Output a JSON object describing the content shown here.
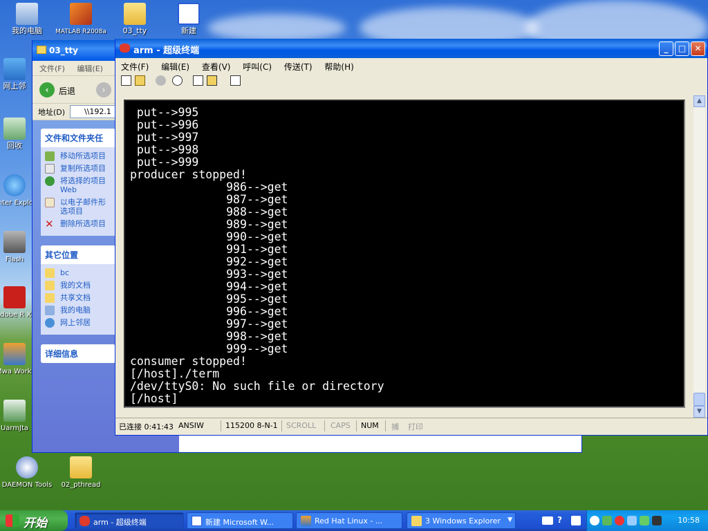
{
  "desktop": {
    "icons": [
      {
        "label": "我的电脑"
      },
      {
        "label": "MATLAB R2008a"
      },
      {
        "label": "03_tty"
      },
      {
        "label": "新建"
      },
      {
        "label": "网上邻"
      },
      {
        "label": "回收"
      },
      {
        "label": "Inter Explo"
      },
      {
        "label": "Flash"
      },
      {
        "label": "Adobe R XI"
      },
      {
        "label": "VMwa Workst"
      },
      {
        "label": "UarmJta"
      },
      {
        "label": "DAEMON Tools"
      },
      {
        "label": "02_pthread"
      }
    ]
  },
  "explorer": {
    "title": "03_tty",
    "menu": [
      "文件(F)",
      "编辑(E)"
    ],
    "back_label": "后退",
    "address_label": "地址(D)",
    "address_value": "\\\\192.1",
    "file_tasks": {
      "title": "文件和文件夹任",
      "items": [
        "移动所选项目",
        "复制所选项目",
        "将选择的项目 Web",
        "以电子邮件形 选项目",
        "删除所选项目"
      ]
    },
    "other_places": {
      "title": "其它位置",
      "items": [
        "bc",
        "我的文档",
        "共享文档",
        "我的电脑",
        "网上邻居"
      ]
    },
    "details": {
      "title": "详细信息"
    }
  },
  "terminal": {
    "title": "arm - 超级终端",
    "menu": [
      "文件(F)",
      "编辑(E)",
      "查看(V)",
      "呼叫(C)",
      "传送(T)",
      "帮助(H)"
    ],
    "lines": [
      " put-->995",
      " put-->996",
      " put-->997",
      " put-->998",
      " put-->999",
      "producer stopped!",
      "              986-->get",
      "              987-->get",
      "              988-->get",
      "              989-->get",
      "              990-->get",
      "              991-->get",
      "              992-->get",
      "              993-->get",
      "              994-->get",
      "              995-->get",
      "              996-->get",
      "              997-->get",
      "              998-->get",
      "              999-->get",
      "consumer stopped!",
      "[/host]./term",
      "/dev/ttyS0: No such file or directory",
      "[/host]"
    ],
    "status": {
      "connected": "已连接 0:41:43",
      "emulation": "ANSIW",
      "port": "115200 8-N-1",
      "scroll": "SCROLL",
      "caps": "CAPS",
      "num": "NUM",
      "capture": "捕",
      "print": "打印"
    }
  },
  "taskbar": {
    "start_label": "开始",
    "buttons": [
      {
        "label": "arm - 超级终端"
      },
      {
        "label": "新建 Microsoft W..."
      },
      {
        "label": "Red Hat Linux - ..."
      },
      {
        "label": "3 Windows Explorer"
      }
    ],
    "clock": "10:58"
  }
}
